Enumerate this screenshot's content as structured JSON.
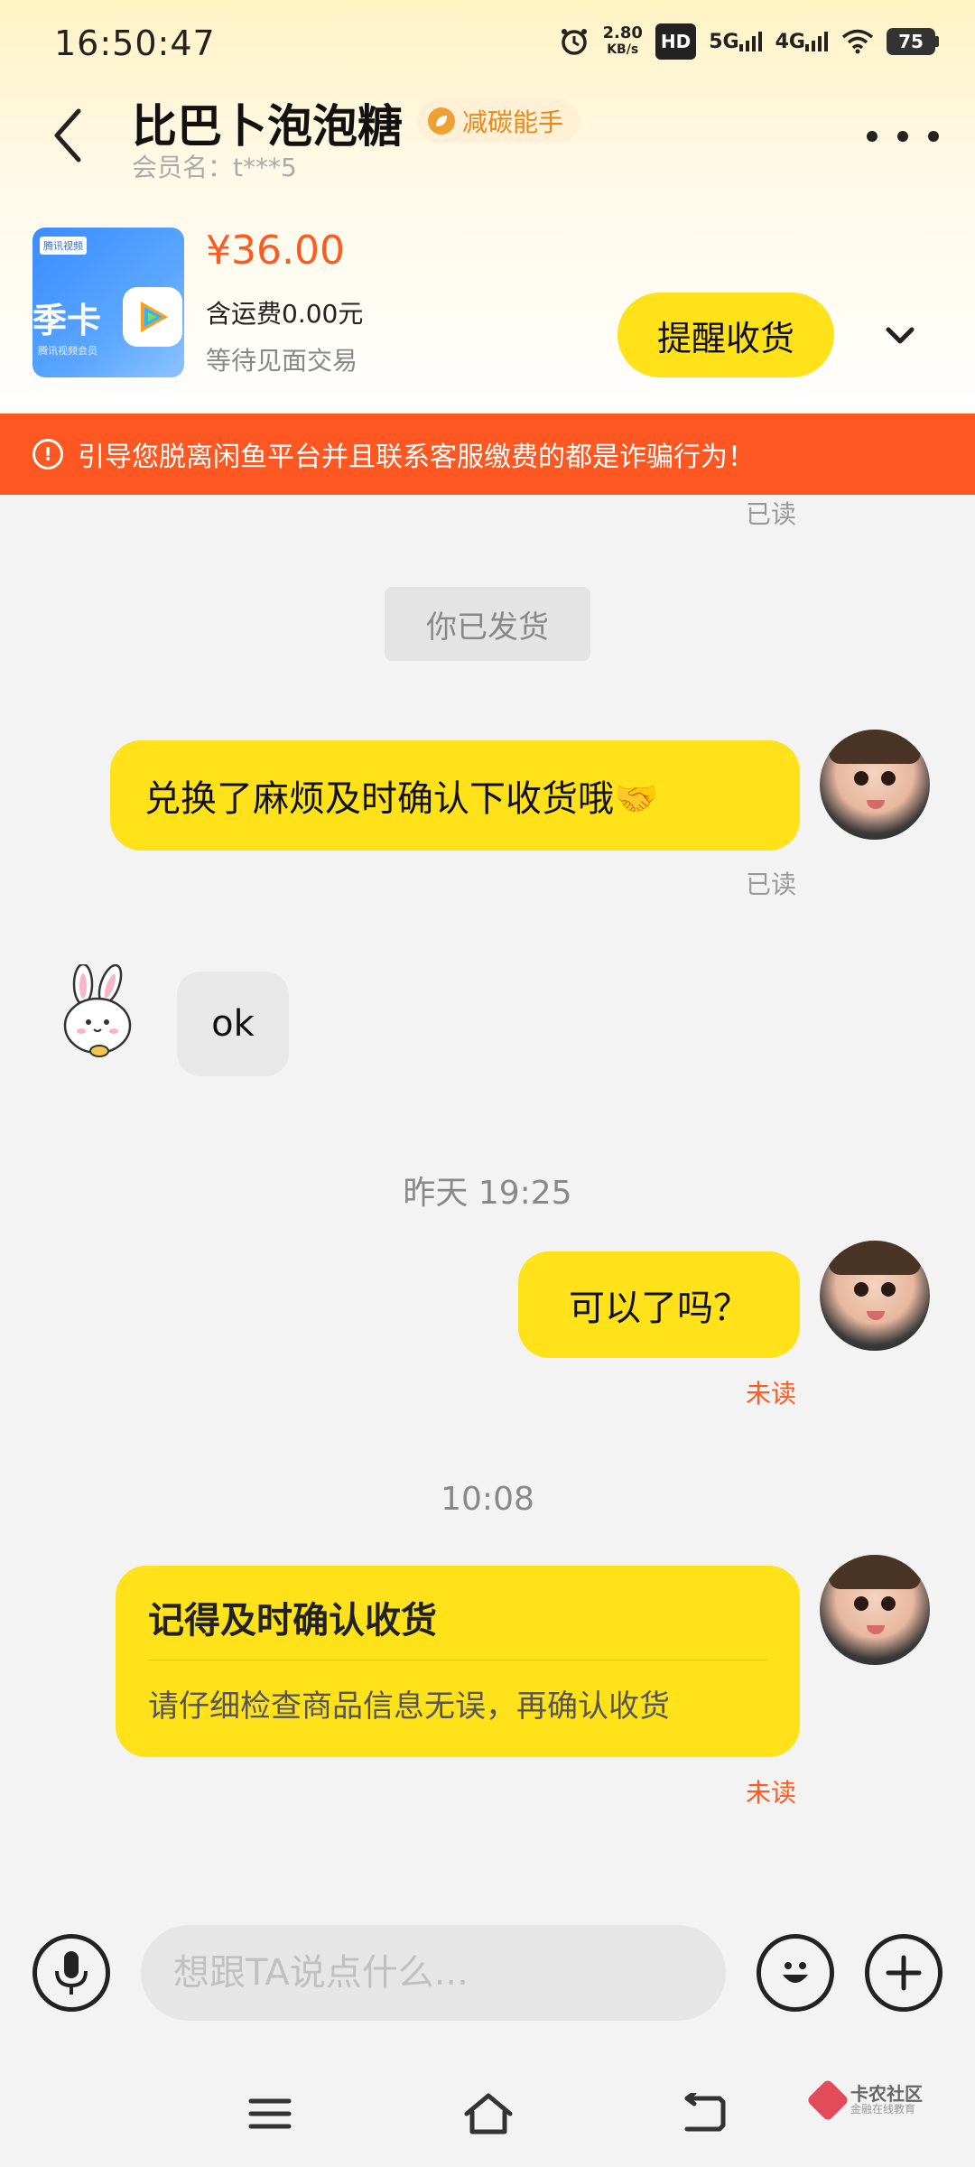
{
  "status_bar": {
    "time": "16:50:47",
    "net_speed_value": "2.80",
    "net_speed_unit": "KB/s",
    "hd_label": "HD",
    "sig1_label": "5G",
    "sig2_label": "4G",
    "battery_level": "75"
  },
  "header": {
    "title": "比巴卜泡泡糖",
    "badge": "减碳能手",
    "subtitle": "会员名：t***5"
  },
  "product": {
    "image_brand": "腾讯视频",
    "image_title": "季卡",
    "image_subtitle": "腾讯视频会员",
    "price": "¥36.00",
    "shipping": "含运费0.00元",
    "status": "等待见面交易",
    "action_button": "提醒收货"
  },
  "warning": {
    "text": "引导您脱离闲鱼平台并且联系客服缴费的都是诈骗行为！"
  },
  "chat": {
    "read_top": "已读",
    "system_pill": "你已发货",
    "msg1": "兑换了麻烦及时确认下收货哦🤝",
    "msg1_status": "已读",
    "msg2": "ok",
    "time1": "昨天 19:25",
    "msg3": "可以了吗？",
    "msg3_status": "未读",
    "time2": "10:08",
    "card_title": "记得及时确认收货",
    "card_desc": "请仔细检查商品信息无误，再确认收货",
    "card_status": "未读"
  },
  "input": {
    "placeholder": "想跟TA说点什么..."
  },
  "watermark": {
    "title": "卡农社区",
    "subtitle": "金融在线教育"
  },
  "colors": {
    "accent_yellow": "#ffe21a",
    "warning_red": "#ff5722",
    "price_orange": "#ff5a1f",
    "unread_orange": "#ff5a1f"
  }
}
